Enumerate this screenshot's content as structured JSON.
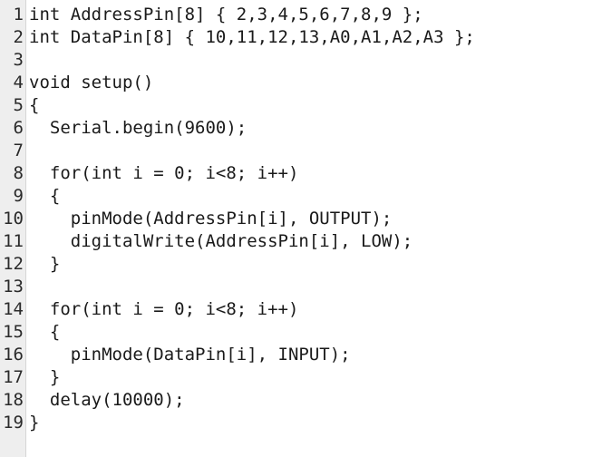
{
  "editor": {
    "lines": [
      {
        "num": "1",
        "text": "int AddressPin[8] { 2,3,4,5,6,7,8,9 };"
      },
      {
        "num": "2",
        "text": "int DataPin[8] { 10,11,12,13,A0,A1,A2,A3 };"
      },
      {
        "num": "3",
        "text": ""
      },
      {
        "num": "4",
        "text": "void setup()"
      },
      {
        "num": "5",
        "text": "{"
      },
      {
        "num": "6",
        "text": "  Serial.begin(9600);"
      },
      {
        "num": "7",
        "text": ""
      },
      {
        "num": "8",
        "text": "  for(int i = 0; i<8; i++)"
      },
      {
        "num": "9",
        "text": "  {"
      },
      {
        "num": "10",
        "text": "    pinMode(AddressPin[i], OUTPUT);"
      },
      {
        "num": "11",
        "text": "    digitalWrite(AddressPin[i], LOW);"
      },
      {
        "num": "12",
        "text": "  }"
      },
      {
        "num": "13",
        "text": ""
      },
      {
        "num": "14",
        "text": "  for(int i = 0; i<8; i++)"
      },
      {
        "num": "15",
        "text": "  {"
      },
      {
        "num": "16",
        "text": "    pinMode(DataPin[i], INPUT);"
      },
      {
        "num": "17",
        "text": "  }"
      },
      {
        "num": "18",
        "text": "  delay(10000);"
      },
      {
        "num": "19",
        "text": "}"
      }
    ]
  }
}
